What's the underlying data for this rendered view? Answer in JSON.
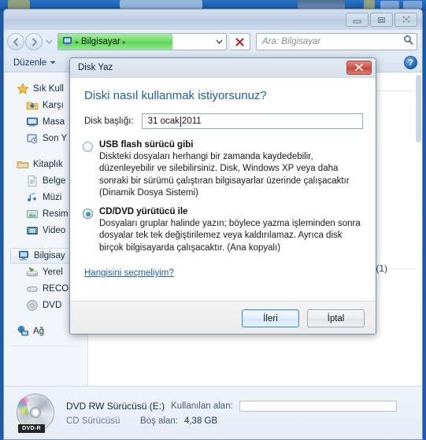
{
  "window": {
    "controls": {
      "minimize": "minimize-button",
      "restore": "restore-button",
      "close": "close-button"
    }
  },
  "address": {
    "crumb_root": "Bilgisayar",
    "separator": "▸",
    "dropdown": "▼",
    "stop_label": "✕",
    "progress_percent": 68
  },
  "search": {
    "placeholder": "Ara: Bilgisayar",
    "icon": "search-icon"
  },
  "toolbar": {
    "organize_label": "Düzenle",
    "caret": "▼",
    "help_label": "?"
  },
  "sidebar": {
    "groups": [
      {
        "label": "Sık Kull",
        "icon": "star-icon",
        "children": [
          {
            "label": "Karşı",
            "icon": "download-folder-icon"
          },
          {
            "label": "Masa",
            "icon": "desktop-icon"
          },
          {
            "label": "Son Y",
            "icon": "recent-places-icon"
          }
        ]
      },
      {
        "label": "Kitaplık",
        "icon": "libraries-icon",
        "children": [
          {
            "label": "Belge",
            "icon": "documents-icon"
          },
          {
            "label": "Müzi",
            "icon": "music-icon"
          },
          {
            "label": "Resim",
            "icon": "pictures-icon"
          },
          {
            "label": "Video",
            "icon": "videos-icon"
          }
        ]
      },
      {
        "label": "Bilgisay",
        "icon": "computer-icon",
        "selected": true,
        "children": [
          {
            "label": "Yerel",
            "icon": "hard-disk-icon"
          },
          {
            "label": "RECO",
            "icon": "recovery-drive-icon"
          },
          {
            "label": "DVD",
            "icon": "dvd-drive-icon"
          }
        ]
      },
      {
        "label": "Ağ",
        "icon": "network-icon",
        "children": []
      }
    ]
  },
  "content": {
    "partial_text": "(1)"
  },
  "statusbar": {
    "drive_name": "DVD RW Sürücüsü (E:)",
    "drive_type": "CD Sürücüsü",
    "used_label": "Kullanılan alan:",
    "used_percent": 0,
    "free_label": "Boş alan:",
    "free_value": "4,38 GB",
    "disc_label": "DVD-R"
  },
  "dialog": {
    "title": "Disk Yaz",
    "close_label": "✕",
    "heading": "Diski nasıl kullanmak istiyorsunuz?",
    "field_label": "Disk başlığı:",
    "field_value_before_caret": "31 ocak ",
    "field_value_after_caret": "2011",
    "options": [
      {
        "title": "USB flash sürücü gibi",
        "desc": "Diskteki dosyaları herhangi bir zamanda kaydedebilir, düzenleyebilir ve silebilirsiniz. Disk, Windows XP veya daha sonraki bir sürümü çalıştıran bilgisayarlar üzerinde çalışacaktır (Dinamik Dosya Sistemi)",
        "selected": false
      },
      {
        "title": "CD/DVD yürütücü ile",
        "desc": "Dosyaları gruplar halinde yazın; böylece yazma işleminden sonra dosyalar tek tek değiştirilemez veya kaldırılamaz. Ayrıca disk birçok bilgisayarda çalışacaktır. (Ana kopyalı)",
        "selected": true
      }
    ],
    "help_link": "Hangisini seçmeliyim?",
    "next_button": "İleri",
    "cancel_button": "İptal"
  },
  "colors": {
    "accent_blue": "#1b5fa8",
    "link_blue": "#1560b8",
    "progress_green": "#5ed65c",
    "close_red": "#c24a3c"
  }
}
